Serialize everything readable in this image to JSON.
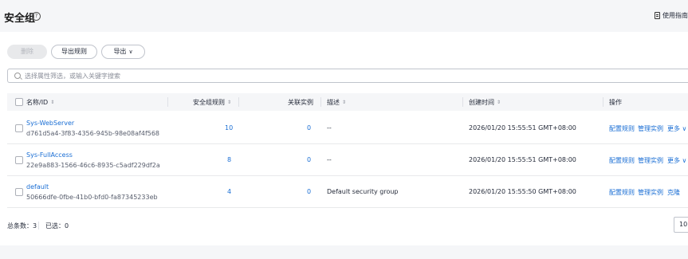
{
  "header": {
    "title": "安全组",
    "help_icon": "question-circle-icon",
    "guide_label": "使用指南"
  },
  "toolbar": {
    "delete_label": "删除",
    "export_rules_label": "导出规则",
    "export_label": "导出",
    "export_chevron": "∨"
  },
  "search": {
    "placeholder": "选择属性筛选，或输入关键字搜索"
  },
  "table": {
    "columns": {
      "name": "名称/ID",
      "rules": "安全组规则",
      "instances": "关联实例",
      "description": "描述",
      "created": "创建时间",
      "actions": "操作"
    },
    "rows": [
      {
        "name": "Sys-WebServer",
        "id": "d761d5a4-3f83-4356-945b-98e08af4f568",
        "rules": "10",
        "instances": "0",
        "description": "--",
        "created": "2026/01/20 15:55:51 GMT+08:00",
        "action1": "配置规则",
        "action2": "管理实例",
        "action3": "更多 ∨"
      },
      {
        "name": "Sys-FullAccess",
        "id": "22e9a883-1566-46c6-8935-c5adf229df2a",
        "rules": "8",
        "instances": "0",
        "description": "--",
        "created": "2026/01/20 15:55:51 GMT+08:00",
        "action1": "配置规则",
        "action2": "管理实例",
        "action3": "更多 ∨"
      },
      {
        "name": "default",
        "id": "50666dfe-0fbe-41b0-bfd0-fa87345233eb",
        "rules": "4",
        "instances": "0",
        "description": "Default security group",
        "created": "2026/01/20 15:55:50 GMT+08:00",
        "action1": "配置规则",
        "action2": "管理实例",
        "action3": "克隆"
      }
    ]
  },
  "footer": {
    "total_label": "总条数：3",
    "selected_label": "已选：0",
    "page_size": "10"
  },
  "colors": {
    "link": "#1a6ed4",
    "background": "#f5f6f8"
  }
}
